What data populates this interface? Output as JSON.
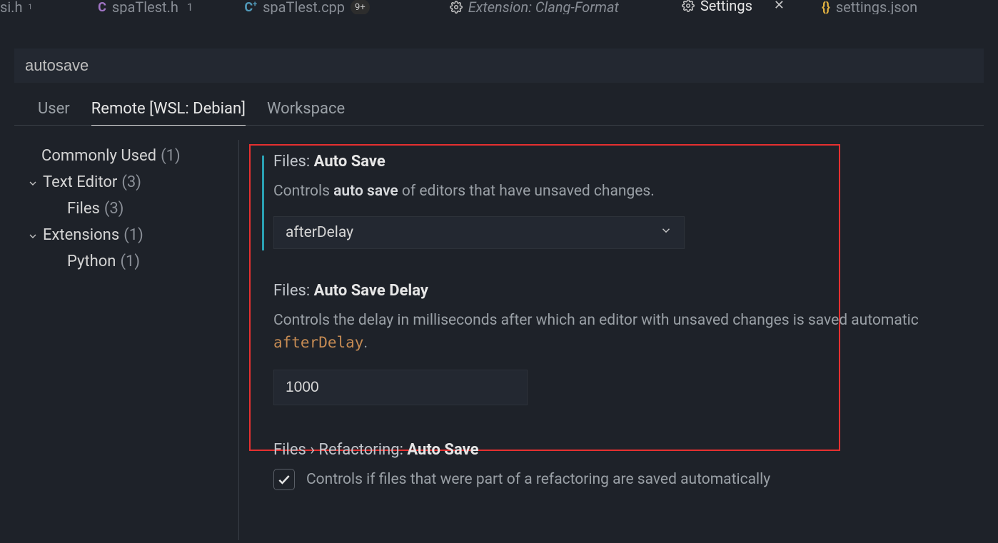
{
  "tabs": {
    "items": [
      {
        "icon": "c-header-icon",
        "label": "spaTlest.h",
        "badge": "1"
      },
      {
        "icon": "cpp-icon",
        "label": "spaTlest.cpp",
        "badge": "9+"
      },
      {
        "icon": "gear-icon",
        "label": "Extension: Clang-Format",
        "italic": true
      },
      {
        "icon": "gear-icon",
        "label": "Settings",
        "active": true,
        "closable": true
      },
      {
        "icon": "braces-icon",
        "label": "settings.json"
      }
    ],
    "leading_partial": "si.h",
    "leading_badge": "1"
  },
  "search": {
    "value": "autosave"
  },
  "scope": {
    "items": [
      {
        "label": "User"
      },
      {
        "label": "Remote [WSL: Debian]",
        "active": true
      },
      {
        "label": "Workspace"
      }
    ]
  },
  "outline": [
    {
      "label": "Commonly Used",
      "count": "(1)"
    },
    {
      "label": "Text Editor",
      "count": "(3)",
      "expandable": true,
      "children": [
        {
          "label": "Files",
          "count": "(3)"
        }
      ]
    },
    {
      "label": "Extensions",
      "count": "(1)",
      "expandable": true,
      "children": [
        {
          "label": "Python",
          "count": "(1)"
        }
      ]
    }
  ],
  "settings": {
    "autoSave": {
      "title_prefix": "Files: ",
      "title_strong": "Auto Save",
      "desc_pre": "Controls ",
      "desc_kw": "auto save",
      "desc_post": " of editors that have unsaved changes.",
      "value": "afterDelay"
    },
    "autoSaveDelay": {
      "title_prefix": "Files: ",
      "title_strong": "Auto Save Delay",
      "desc_pre": "Controls the delay in milliseconds after which an editor with unsaved changes is saved automatic",
      "desc_code": "afterDelay",
      "desc_suffix": ".",
      "value": "1000"
    },
    "refactorAutoSave": {
      "title_prefix": "Files › Refactoring: ",
      "title_strong": "Auto Save",
      "checked": true,
      "label": "Controls if files that were part of a refactoring are saved automatically"
    }
  }
}
